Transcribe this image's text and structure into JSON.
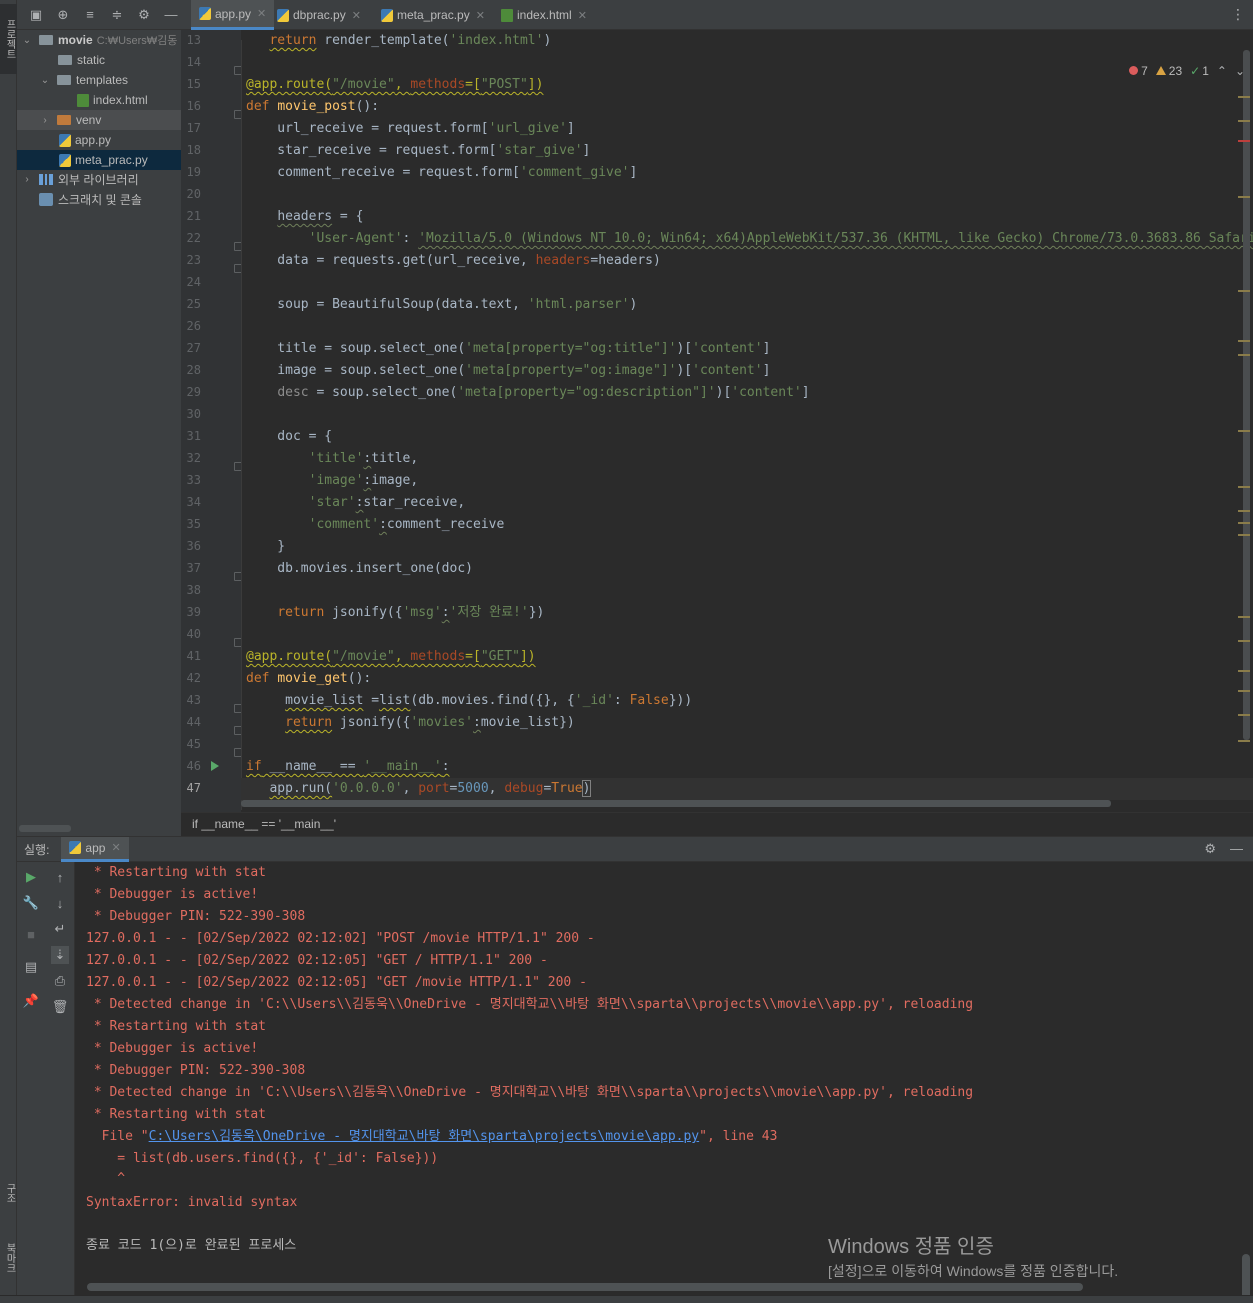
{
  "left_strip": {
    "project_tab": "프로젝트",
    "structure_tab": "구조",
    "bookmarks_tab": "북마크"
  },
  "project": {
    "root_name": "movie",
    "root_path": "C:₩Users₩김동",
    "items": [
      {
        "label": "static"
      },
      {
        "label": "templates"
      },
      {
        "label": "index.html"
      },
      {
        "label": "venv"
      },
      {
        "label": "app.py"
      },
      {
        "label": "meta_prac.py"
      },
      {
        "label": "외부 라이브러리"
      },
      {
        "label": "스크래치 및 콘솔"
      }
    ]
  },
  "tabs": [
    {
      "label": "app.py"
    },
    {
      "label": "dbprac.py"
    },
    {
      "label": "meta_prac.py"
    },
    {
      "label": "index.html"
    }
  ],
  "inspections": {
    "errors": "7",
    "warnings": "23",
    "ok": "1"
  },
  "line_numbers": [
    "13",
    "14",
    "15",
    "16",
    "17",
    "18",
    "19",
    "20",
    "21",
    "22",
    "23",
    "24",
    "25",
    "26",
    "27",
    "28",
    "29",
    "30",
    "31",
    "32",
    "33",
    "34",
    "35",
    "36",
    "37",
    "38",
    "39",
    "40",
    "41",
    "42",
    "43",
    "44",
    "45",
    "46",
    "47"
  ],
  "code_breadcrumb": "if __name__ == '__main__'",
  "run": {
    "label": "실행:",
    "tab": "app",
    "console": [
      " * Restarting with stat",
      " * Debugger is active!",
      " * Debugger PIN: 522-390-308",
      "127.0.0.1 - - [02/Sep/2022 02:12:02] \"POST /movie HTTP/1.1\" 200 -",
      "127.0.0.1 - - [02/Sep/2022 02:12:05] \"GET / HTTP/1.1\" 200 -",
      "127.0.0.1 - - [02/Sep/2022 02:12:05] \"GET /movie HTTP/1.1\" 200 -",
      " * Detected change in 'C:\\\\Users\\\\김동욱\\\\OneDrive - 명지대학교\\\\바탕 화면\\\\sparta\\\\projects\\\\movie\\\\app.py', reloading",
      " * Restarting with stat",
      " * Debugger is active!",
      " * Debugger PIN: 522-390-308",
      " * Detected change in 'C:\\\\Users\\\\김동욱\\\\OneDrive - 명지대학교\\\\바탕 화면\\\\sparta\\\\projects\\\\movie\\\\app.py', reloading",
      " * Restarting with stat"
    ],
    "trace_file_prefix": "  File \"",
    "trace_file_link": "C:\\Users\\김동욱\\OneDrive - 명지대학교\\바탕 화면\\sparta\\projects\\movie\\app.py",
    "trace_file_suffix": "\", line 43",
    "trace_code": "    = list(db.users.find({}, {'_id': False}))",
    "trace_caret": "    ^",
    "error": "SyntaxError: invalid syntax",
    "exit": "종료 코드 1(으)로 완료된 프로세스"
  },
  "watermark": {
    "title": "Windows 정품 인증",
    "subtitle": "[설정]으로 이동하여 Windows를 정품 인증합니다."
  },
  "colors": {
    "keyword": "#cc7832",
    "string": "#6a8759",
    "decorator": "#bbb529",
    "function": "#ffc66d",
    "number": "#6897bb",
    "console_error": "#e06c60",
    "link": "#5394ec"
  },
  "icons": {
    "toolbar": [
      "select-opened-file-icon",
      "crosshair-icon",
      "expand-all-icon",
      "collapse-all-icon",
      "gear-icon",
      "minimize-icon"
    ],
    "run_tools": [
      "rerun-icon",
      "wrench-icon",
      "stop-icon",
      "layout-icon",
      "pin-icon",
      "up-arrow-icon",
      "down-arrow-icon",
      "soft-wrap-icon",
      "scroll-to-end-icon",
      "print-icon",
      "trash-icon"
    ]
  }
}
